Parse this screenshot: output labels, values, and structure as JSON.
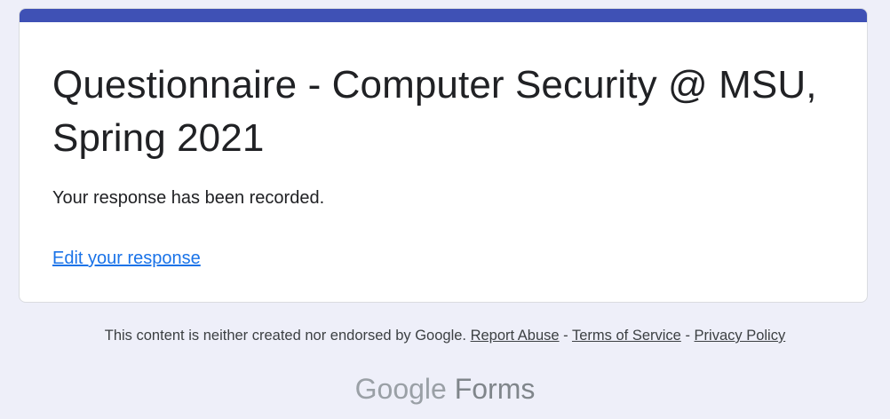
{
  "form": {
    "title": "Questionnaire - Computer Security @ MSU, Spring 2021",
    "confirmation_message": "Your response has been recorded.",
    "edit_link_label": "Edit your response"
  },
  "footer": {
    "disclaimer": "This content is neither created nor endorsed by Google.",
    "separator": "-",
    "links": {
      "report_abuse": "Report Abuse",
      "terms_of_service": "Terms of Service",
      "privacy_policy": "Privacy Policy"
    }
  },
  "branding": {
    "google": "Google",
    "forms": "Forms"
  },
  "colors": {
    "accent": "#3f51b5",
    "link": "#1a73e8",
    "background": "#eeeff9"
  }
}
